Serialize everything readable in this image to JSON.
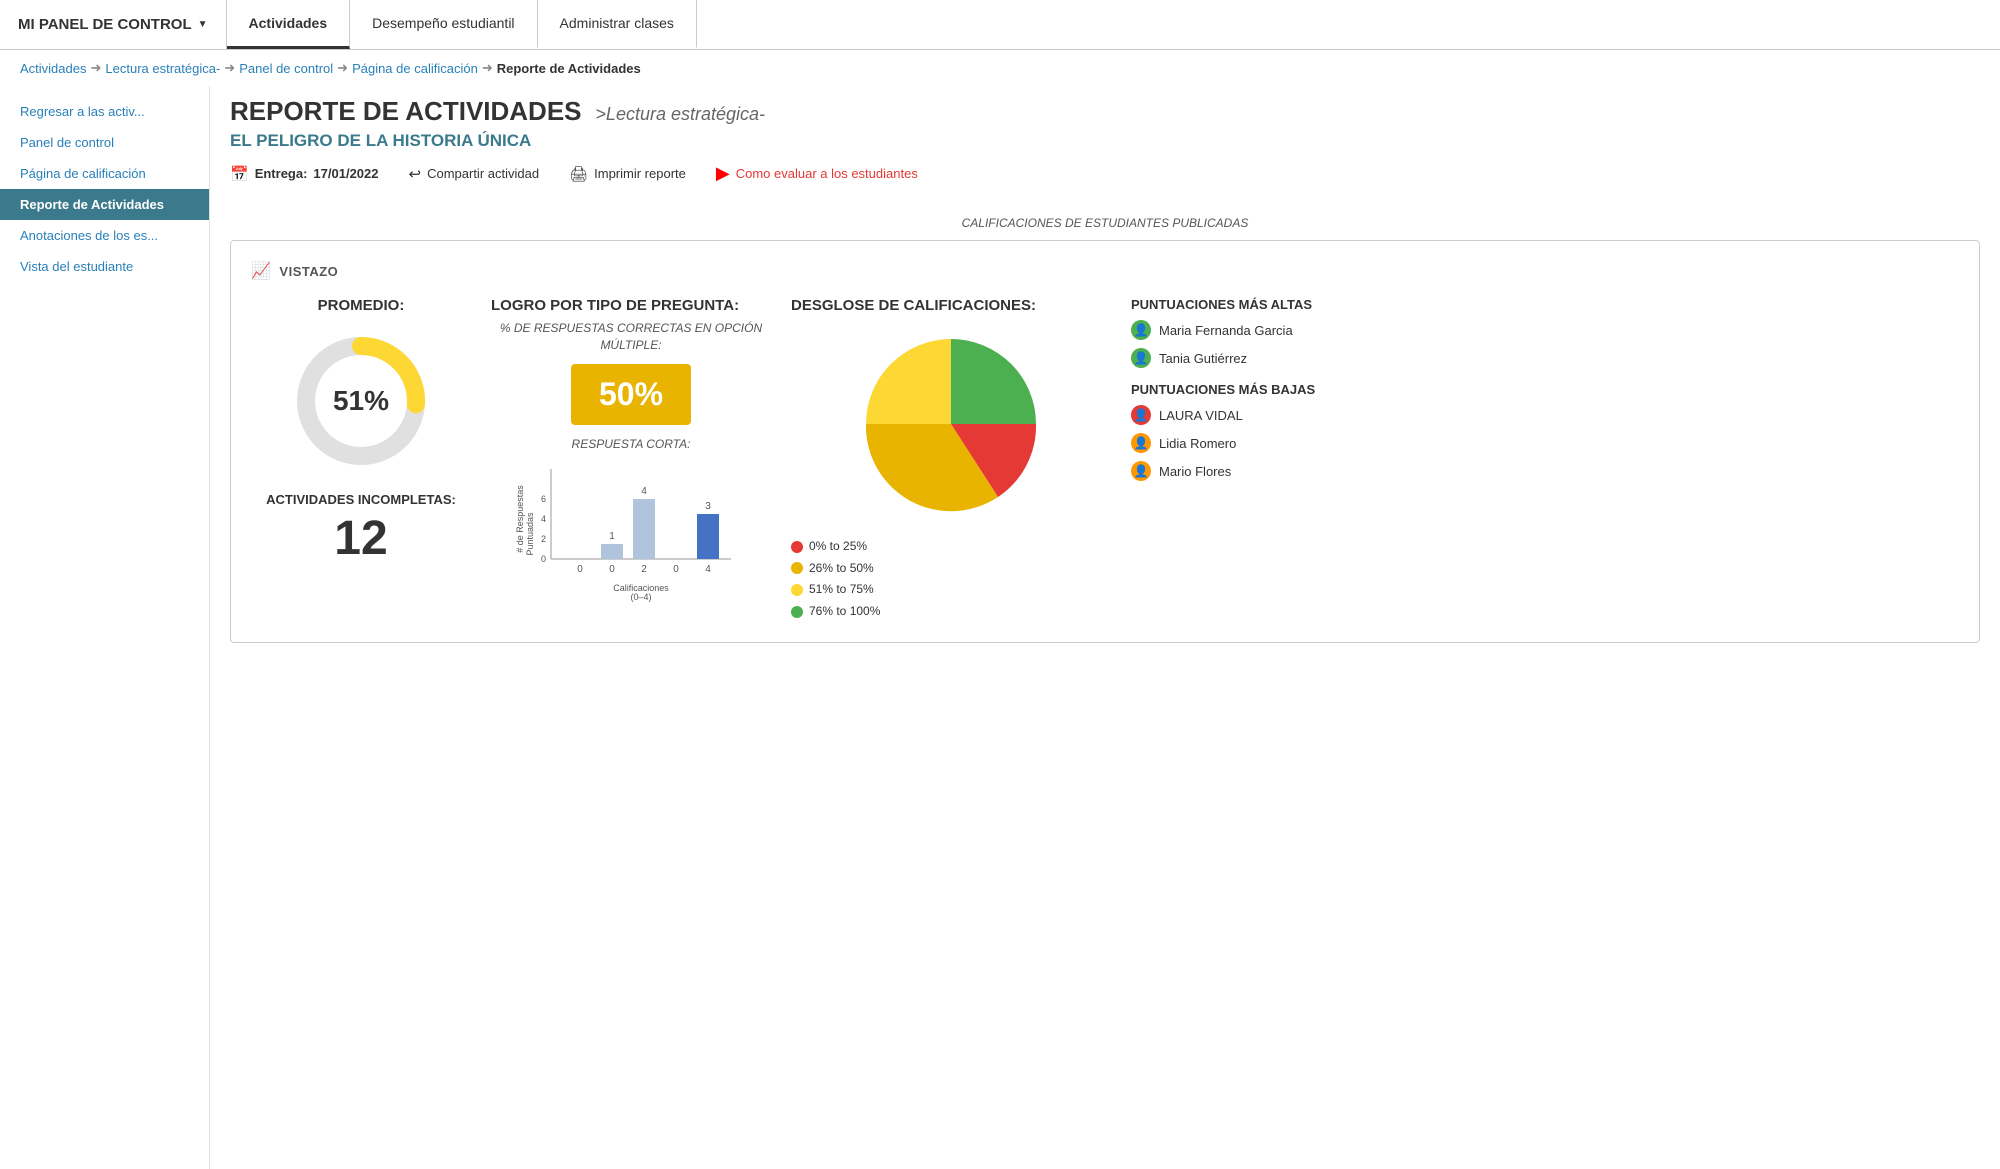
{
  "header": {
    "panel_title": "MI PANEL DE CONTROL",
    "panel_arrow": "▼",
    "tabs": [
      {
        "label": "Actividades",
        "active": true
      },
      {
        "label": "Desempeño estudiantil",
        "active": false
      },
      {
        "label": "Administrar clases",
        "active": false
      }
    ]
  },
  "breadcrumb": {
    "items": [
      "Actividades",
      "Lectura estratégica-",
      "Panel de control",
      "Página de calificación",
      "Reporte de Actividades"
    ]
  },
  "sidebar": {
    "items": [
      {
        "label": "Regresar a las activ...",
        "active": false
      },
      {
        "label": "Panel de control",
        "active": false
      },
      {
        "label": "Página de calificación",
        "active": false
      },
      {
        "label": "Reporte de Actividades",
        "active": true
      },
      {
        "label": "Anotaciones de los es...",
        "active": false
      },
      {
        "label": "Vista del estudiante",
        "active": false
      }
    ]
  },
  "report": {
    "title": "REPORTE DE ACTIVIDADES",
    "course": ">Lectura estratégica-",
    "subtitle": "EL PELIGRO DE LA HISTORIA ÚNICA",
    "delivery_label": "Entrega:",
    "delivery_date": "17/01/2022",
    "share_label": "Compartir actividad",
    "print_label": "Imprimir reporte",
    "youtube_label": "Como evaluar a los estudiantes",
    "grades_published": "CALIFICACIONES DE ESTUDIANTES PUBLICADAS"
  },
  "vistazo": {
    "header": "VISTAZO",
    "promedio": {
      "title": "PROMEDIO:",
      "percent": 51,
      "percent_label": "51%",
      "incompletas_label": "ACTIVIDADES INCOMPLETAS:",
      "incompletas_num": "12"
    },
    "logro": {
      "title": "LOGRO POR TIPO DE PREGUNTA:",
      "mc_label": "% DE RESPUESTAS CORRECTAS EN OPCIÓN MÚLTIPLE:",
      "mc_percent": "50%",
      "short_answer_label": "RESPUESTA CORTA:",
      "bar_data": {
        "y_label": "# de Respuestas Puntuadas",
        "x_label": "Calificaciones (0–4)",
        "bars": [
          {
            "x": 0,
            "value": 0,
            "label": "0"
          },
          {
            "x": 1,
            "value": 1,
            "label": "1"
          },
          {
            "x": 2,
            "value": 4,
            "label": "4"
          },
          {
            "x": 3,
            "value": 0,
            "label": "0"
          },
          {
            "x": 4,
            "value": 3,
            "label": "3"
          }
        ],
        "y_max": 6,
        "x_ticks": [
          "0",
          "2",
          "4"
        ]
      }
    },
    "desglose": {
      "title": "DESGLOSE DE CALIFICACIONES:",
      "legend": [
        {
          "label": "0% to 25%",
          "color": "#e53935"
        },
        {
          "label": "26% to 50%",
          "color": "#e8b400"
        },
        {
          "label": "51% to 75%",
          "color": "#fdd835"
        },
        {
          "label": "76% to 100%",
          "color": "#4caf50"
        }
      ],
      "pie_segments": [
        {
          "label": "0-25%",
          "color": "#e53935",
          "percent": 15
        },
        {
          "label": "26-50%",
          "color": "#e8b400",
          "percent": 25
        },
        {
          "label": "51-75%",
          "color": "#fdd835",
          "percent": 35
        },
        {
          "label": "76-100%",
          "color": "#4caf50",
          "percent": 25
        }
      ]
    },
    "puntuaciones": {
      "highest_title": "PUNTUACIONES MÁS ALTAS",
      "highest": [
        {
          "name": "Maria Fernanda Garcia",
          "avatar_color": "green"
        },
        {
          "name": "Tania Gutiérrez",
          "avatar_color": "green"
        }
      ],
      "lowest_title": "PUNTUACIONES MÁS BAJAS",
      "lowest": [
        {
          "name": "LAURA VIDAL",
          "avatar_color": "red"
        },
        {
          "name": "Lidia Romero",
          "avatar_color": "orange"
        },
        {
          "name": "Mario Flores",
          "avatar_color": "orange"
        }
      ]
    }
  }
}
